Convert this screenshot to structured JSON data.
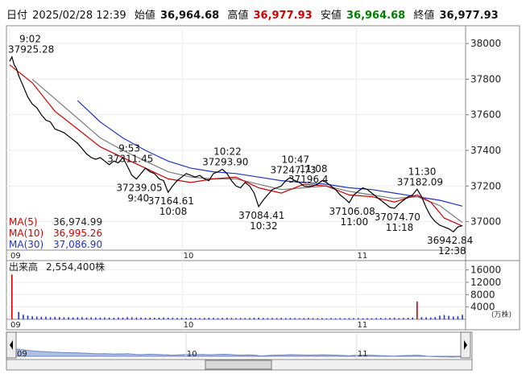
{
  "header": {
    "date_label": "日付",
    "datetime": "2025/02/28 12:39",
    "open_label": "始値",
    "open": "36,964.68",
    "high_label": "高値",
    "high": "36,977.93",
    "low_label": "安値",
    "low": "36,964.68",
    "close_label": "終値",
    "close": "36,977.93"
  },
  "colors": {
    "price": "#000000",
    "ma5": "#d40000",
    "ma10": "#7a7a7a",
    "ma30": "#2233cc",
    "high": "#d40000",
    "low": "#008000",
    "volume": "#2233cc",
    "volume_spike": "#d40000",
    "nav_fill": "#aebfe2"
  },
  "legend": [
    {
      "label": "MA(5)",
      "value": "36,974.99",
      "color": "#d40000",
      "text_color": "#222222"
    },
    {
      "label": "MA(10)",
      "value": "36,995.26",
      "color": "#d40000",
      "text_color": "#d40000"
    },
    {
      "label": "MA(30)",
      "value": "37,086.90",
      "color": "#2233cc",
      "text_color": "#2233cc"
    }
  ],
  "volume_panel": {
    "title": "出来高",
    "value": "2,554,400株",
    "unit": "(万株)",
    "ticks": [
      "16000",
      "12000",
      "8000",
      "4000"
    ]
  },
  "chart_data": {
    "type": "line",
    "title": "",
    "x_range": [
      0,
      100
    ],
    "y_range": [
      36840,
      38100
    ],
    "y_ticks": [
      37000,
      37200,
      37400,
      37600,
      37800,
      38000
    ],
    "x_ticks": [
      {
        "pos": 0,
        "label": "09"
      },
      {
        "pos": 38.2,
        "label": "10"
      },
      {
        "pos": 76.6,
        "label": "11"
      }
    ],
    "price": [
      [
        0,
        37900
      ],
      [
        0.5,
        37925.28
      ],
      [
        1,
        37880
      ],
      [
        1.5,
        37860
      ],
      [
        2,
        37820
      ],
      [
        3,
        37760
      ],
      [
        4,
        37700
      ],
      [
        5,
        37660
      ],
      [
        6,
        37640
      ],
      [
        7,
        37600
      ],
      [
        8,
        37570
      ],
      [
        9,
        37560
      ],
      [
        10,
        37520
      ],
      [
        11,
        37510
      ],
      [
        12,
        37500
      ],
      [
        13,
        37480
      ],
      [
        14,
        37460
      ],
      [
        15,
        37440
      ],
      [
        16,
        37410
      ],
      [
        17,
        37380
      ],
      [
        18,
        37360
      ],
      [
        19,
        37350
      ],
      [
        20,
        37360
      ],
      [
        21,
        37340
      ],
      [
        22,
        37320
      ],
      [
        23,
        37340
      ],
      [
        24,
        37330
      ],
      [
        25,
        37360
      ],
      [
        26,
        37311.45
      ],
      [
        27,
        37260
      ],
      [
        28,
        37239.05
      ],
      [
        29,
        37270
      ],
      [
        30,
        37300
      ],
      [
        31,
        37280
      ],
      [
        32,
        37270
      ],
      [
        33,
        37240
      ],
      [
        34,
        37230
      ],
      [
        35,
        37164.61
      ],
      [
        36,
        37200
      ],
      [
        37,
        37230
      ],
      [
        38,
        37250
      ],
      [
        39,
        37270
      ],
      [
        40,
        37260
      ],
      [
        41,
        37250
      ],
      [
        42,
        37260
      ],
      [
        43,
        37240
      ],
      [
        44,
        37230
      ],
      [
        45,
        37270
      ],
      [
        46,
        37280
      ],
      [
        47,
        37293.9
      ],
      [
        48,
        37270
      ],
      [
        49,
        37230
      ],
      [
        50,
        37200
      ],
      [
        51,
        37190
      ],
      [
        52,
        37220
      ],
      [
        53,
        37200
      ],
      [
        54,
        37160
      ],
      [
        55,
        37084.41
      ],
      [
        56,
        37120
      ],
      [
        57,
        37150
      ],
      [
        58,
        37180
      ],
      [
        59,
        37190
      ],
      [
        60,
        37200
      ],
      [
        61,
        37230
      ],
      [
        62,
        37247.73
      ],
      [
        63,
        37230
      ],
      [
        64,
        37220
      ],
      [
        65,
        37200
      ],
      [
        66,
        37196.4
      ],
      [
        67,
        37200
      ],
      [
        68,
        37210
      ],
      [
        69,
        37230
      ],
      [
        70,
        37220
      ],
      [
        71,
        37200
      ],
      [
        72,
        37180
      ],
      [
        73,
        37150
      ],
      [
        74,
        37130
      ],
      [
        75,
        37106.08
      ],
      [
        76,
        37150
      ],
      [
        77,
        37170
      ],
      [
        78,
        37190
      ],
      [
        79,
        37180
      ],
      [
        80,
        37160
      ],
      [
        81,
        37140
      ],
      [
        82,
        37120
      ],
      [
        83,
        37100
      ],
      [
        84,
        37080
      ],
      [
        85,
        37074.7
      ],
      [
        86,
        37100
      ],
      [
        87,
        37120
      ],
      [
        88,
        37140
      ],
      [
        89,
        37150
      ],
      [
        90,
        37182.09
      ],
      [
        91,
        37140
      ],
      [
        92,
        37080
      ],
      [
        93,
        37030
      ],
      [
        94,
        37000
      ],
      [
        95,
        36980
      ],
      [
        96,
        36970
      ],
      [
        97,
        36960
      ],
      [
        98,
        36942.84
      ],
      [
        99,
        36970
      ],
      [
        100,
        36977.93
      ]
    ],
    "ma5": [
      [
        0,
        37880
      ],
      [
        5,
        37780
      ],
      [
        10,
        37620
      ],
      [
        15,
        37520
      ],
      [
        20,
        37420
      ],
      [
        25,
        37360
      ],
      [
        30,
        37300
      ],
      [
        35,
        37240
      ],
      [
        40,
        37220
      ],
      [
        45,
        37240
      ],
      [
        50,
        37250
      ],
      [
        55,
        37190
      ],
      [
        60,
        37160
      ],
      [
        65,
        37210
      ],
      [
        70,
        37200
      ],
      [
        75,
        37150
      ],
      [
        80,
        37140
      ],
      [
        85,
        37110
      ],
      [
        90,
        37150
      ],
      [
        93,
        37110
      ],
      [
        96,
        37020
      ],
      [
        100,
        36974.99
      ]
    ],
    "ma10": [
      [
        5,
        37800
      ],
      [
        10,
        37690
      ],
      [
        15,
        37580
      ],
      [
        20,
        37470
      ],
      [
        25,
        37400
      ],
      [
        30,
        37340
      ],
      [
        35,
        37280
      ],
      [
        40,
        37250
      ],
      [
        45,
        37240
      ],
      [
        50,
        37240
      ],
      [
        55,
        37210
      ],
      [
        60,
        37180
      ],
      [
        65,
        37190
      ],
      [
        70,
        37200
      ],
      [
        75,
        37170
      ],
      [
        80,
        37150
      ],
      [
        85,
        37130
      ],
      [
        90,
        37140
      ],
      [
        95,
        37090
      ],
      [
        100,
        36995.26
      ]
    ],
    "ma30": [
      [
        15,
        37680
      ],
      [
        20,
        37560
      ],
      [
        25,
        37470
      ],
      [
        30,
        37400
      ],
      [
        35,
        37340
      ],
      [
        40,
        37300
      ],
      [
        45,
        37280
      ],
      [
        50,
        37270
      ],
      [
        55,
        37250
      ],
      [
        60,
        37230
      ],
      [
        65,
        37220
      ],
      [
        70,
        37210
      ],
      [
        75,
        37190
      ],
      [
        80,
        37180
      ],
      [
        85,
        37160
      ],
      [
        90,
        37140
      ],
      [
        95,
        37120
      ],
      [
        100,
        37086.9
      ]
    ],
    "annotations": [
      {
        "x": 0.5,
        "y": 37925.28,
        "time": "9:02",
        "value": "37925.28",
        "pos": "top"
      },
      {
        "x": 26,
        "y": 37311.45,
        "time": "9:53",
        "value": "37311.45",
        "pos": "top"
      },
      {
        "x": 28,
        "y": 37239.05,
        "time": "9:40",
        "value": "37239.05",
        "pos": "bottom"
      },
      {
        "x": 47,
        "y": 37293.9,
        "time": "10:22",
        "value": "37293.90",
        "pos": "top"
      },
      {
        "x": 35,
        "y": 37164.61,
        "time": "10:08",
        "value": "37164.61",
        "pos": "bottom"
      },
      {
        "x": 55,
        "y": 37084.41,
        "time": "10:32",
        "value": "37084.41",
        "pos": "bottom"
      },
      {
        "x": 62,
        "y": 37247.73,
        "time": "10:47",
        "value": "37247.73",
        "pos": "top"
      },
      {
        "x": 66,
        "y": 37196.4,
        "time": "11:08",
        "value": "37196.4",
        "pos": "top"
      },
      {
        "x": 75,
        "y": 37106.08,
        "time": "11:00",
        "value": "37106.08",
        "pos": "bottom"
      },
      {
        "x": 90,
        "y": 37182.09,
        "time": "11:30",
        "value": "37182.09",
        "pos": "top"
      },
      {
        "x": 85,
        "y": 37074.7,
        "time": "11:18",
        "value": "37074.70",
        "pos": "bottom"
      },
      {
        "x": 98,
        "y": 36942.84,
        "time": "12:38",
        "value": "36942.84",
        "pos": "bottom"
      }
    ],
    "volume": {
      "y_range": [
        0,
        18000
      ],
      "bars": [
        [
          0.5,
          14500
        ],
        [
          2,
          2400
        ],
        [
          3,
          1500
        ],
        [
          4,
          1200
        ],
        [
          5,
          1000
        ],
        [
          6,
          900
        ],
        [
          7,
          800
        ],
        [
          8,
          850
        ],
        [
          9,
          700
        ],
        [
          10,
          750
        ],
        [
          11,
          700
        ],
        [
          12,
          650
        ],
        [
          13,
          700
        ],
        [
          14,
          600
        ],
        [
          15,
          650
        ],
        [
          16,
          700
        ],
        [
          17,
          600
        ],
        [
          18,
          650
        ],
        [
          19,
          600
        ],
        [
          20,
          550
        ],
        [
          21,
          600
        ],
        [
          22,
          550
        ],
        [
          23,
          500
        ],
        [
          24,
          600
        ],
        [
          25,
          550
        ],
        [
          26,
          700
        ],
        [
          27,
          650
        ],
        [
          28,
          600
        ],
        [
          29,
          550
        ],
        [
          30,
          500
        ],
        [
          31,
          550
        ],
        [
          32,
          500
        ],
        [
          33,
          550
        ],
        [
          34,
          600
        ],
        [
          35,
          550
        ],
        [
          36,
          500
        ],
        [
          37,
          450
        ],
        [
          38,
          500
        ],
        [
          39,
          450
        ],
        [
          40,
          500
        ],
        [
          41,
          450
        ],
        [
          42,
          400
        ],
        [
          43,
          450
        ],
        [
          44,
          500
        ],
        [
          45,
          450
        ],
        [
          46,
          400
        ],
        [
          47,
          450
        ],
        [
          48,
          500
        ],
        [
          49,
          450
        ],
        [
          50,
          400
        ],
        [
          51,
          450
        ],
        [
          52,
          400
        ],
        [
          53,
          450
        ],
        [
          54,
          500
        ],
        [
          55,
          550
        ],
        [
          56,
          450
        ],
        [
          57,
          400
        ],
        [
          58,
          450
        ],
        [
          59,
          400
        ],
        [
          60,
          450
        ],
        [
          61,
          400
        ],
        [
          62,
          450
        ],
        [
          63,
          400
        ],
        [
          64,
          350
        ],
        [
          65,
          400
        ],
        [
          66,
          450
        ],
        [
          67,
          400
        ],
        [
          68,
          350
        ],
        [
          69,
          400
        ],
        [
          70,
          350
        ],
        [
          71,
          400
        ],
        [
          72,
          350
        ],
        [
          73,
          400
        ],
        [
          74,
          350
        ],
        [
          75,
          400
        ],
        [
          76,
          350
        ],
        [
          77,
          400
        ],
        [
          78,
          350
        ],
        [
          79,
          400
        ],
        [
          80,
          350
        ],
        [
          81,
          400
        ],
        [
          82,
          450
        ],
        [
          83,
          400
        ],
        [
          84,
          450
        ],
        [
          85,
          500
        ],
        [
          86,
          400
        ],
        [
          87,
          450
        ],
        [
          88,
          500
        ],
        [
          89,
          600
        ],
        [
          90,
          5800
        ],
        [
          91,
          700
        ],
        [
          92,
          650
        ],
        [
          93,
          600
        ],
        [
          94,
          700
        ],
        [
          95,
          1200
        ],
        [
          96,
          1400
        ],
        [
          97,
          1100
        ],
        [
          98,
          900
        ],
        [
          99,
          1000
        ],
        [
          100,
          1500
        ]
      ]
    },
    "navigator": {
      "x_ticks": [
        {
          "pos": 0,
          "label": "09"
        },
        {
          "pos": 38.2,
          "label": "10"
        },
        {
          "pos": 76.6,
          "label": "11"
        }
      ]
    }
  }
}
